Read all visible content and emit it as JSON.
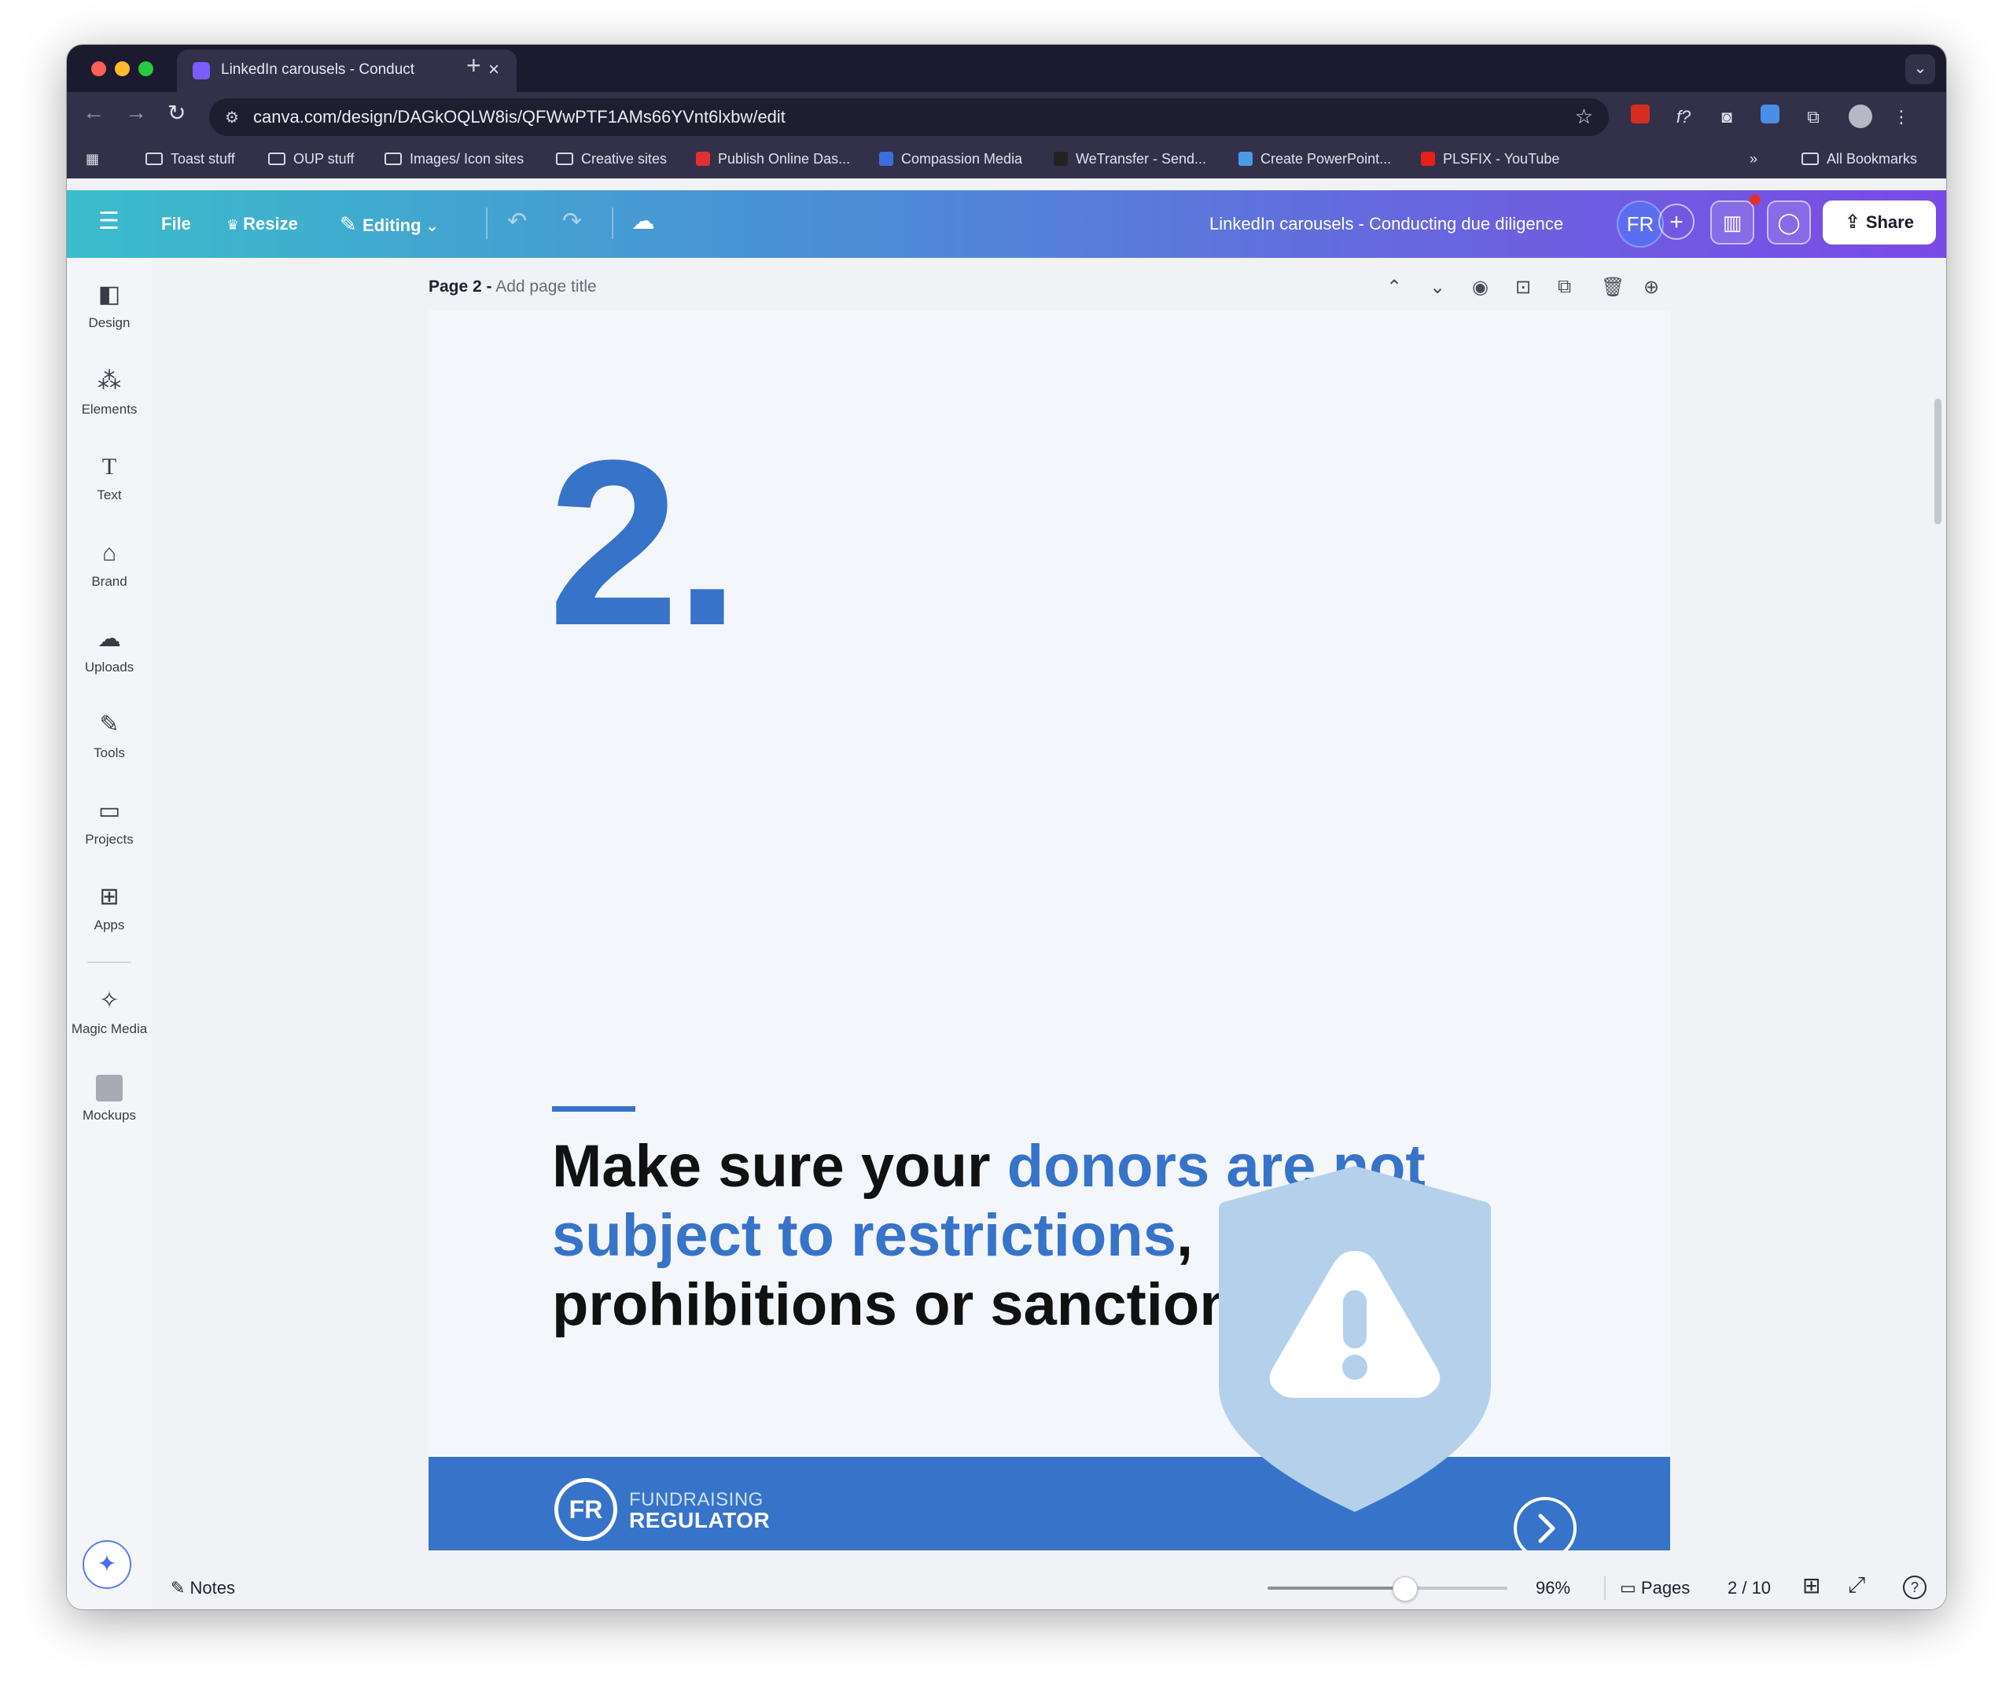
{
  "browser": {
    "tab_title": "LinkedIn carousels - Conduct",
    "url": "canva.com/design/DAGkOQLW8is/QFWwPTF1AMs66YVnt6lxbw/edit",
    "bookmarks": [
      "Toast stuff",
      "OUP stuff",
      "Images/ Icon sites",
      "Creative sites",
      "Publish Online Das...",
      "Compassion Media",
      "WeTransfer - Send...",
      "Create PowerPoint...",
      "PLSFIX - YouTube"
    ],
    "all_bookmarks": "All Bookmarks",
    "extension_fx": "f?"
  },
  "header": {
    "file": "File",
    "resize": "Resize",
    "editing": "Editing",
    "doc_title": "LinkedIn carousels - Conducting due diligence",
    "avatar": "FR",
    "share": "Share"
  },
  "sidebar": {
    "items": [
      {
        "label": "Design",
        "icon": "design-icon"
      },
      {
        "label": "Elements",
        "icon": "elements-icon"
      },
      {
        "label": "Text",
        "icon": "text-icon"
      },
      {
        "label": "Brand",
        "icon": "brand-icon"
      },
      {
        "label": "Uploads",
        "icon": "uploads-icon"
      },
      {
        "label": "Tools",
        "icon": "tools-icon"
      },
      {
        "label": "Projects",
        "icon": "projects-icon"
      },
      {
        "label": "Apps",
        "icon": "apps-icon"
      },
      {
        "label": "Magic Media",
        "icon": "magic-media-icon"
      },
      {
        "label": "Mockups",
        "icon": "mockups-icon"
      }
    ]
  },
  "page": {
    "label": "Page 2 -",
    "title_placeholder": "Add page title"
  },
  "slide": {
    "number": "2.",
    "headline_part1": "Make sure your ",
    "headline_blue": "donors are not subject to restrictions",
    "headline_part2": ", prohibitions or sanctions.",
    "logo_mark": "FR",
    "logo_line1": "FUNDRAISING",
    "logo_line2": "REGULATOR"
  },
  "colors": {
    "brand_blue": "#3773c9",
    "shield_blue": "#b5d0eb",
    "canvas_bg": "#f3f6fb"
  },
  "bottom": {
    "notes": "Notes",
    "zoom": "96%",
    "zoom_fraction": 0.57,
    "pages": "Pages",
    "page_count": "2 / 10"
  }
}
